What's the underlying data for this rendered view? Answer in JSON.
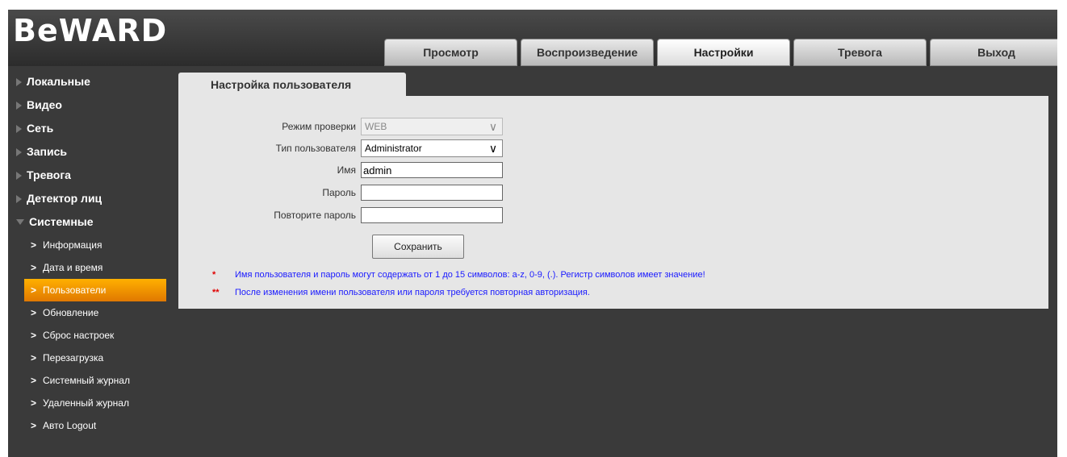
{
  "brand": "BeWARD",
  "tabs": [
    "Просмотр",
    "Воспроизведение",
    "Настройки",
    "Тревога",
    "Выход"
  ],
  "sidebar": {
    "sections": [
      "Локальные",
      "Видео",
      "Сеть",
      "Запись",
      "Тревога",
      "Детектор лиц",
      "Системные"
    ],
    "subitems": [
      "Информация",
      "Дата и время",
      "Пользователи",
      "Обновление",
      "Сброс настроек",
      "Перезагрузка",
      "Системный журнал",
      "Удаленный журнал",
      "Авто Logout"
    ]
  },
  "page": {
    "title": "Настройка пользователя"
  },
  "form": {
    "mode_label": "Режим проверки",
    "mode_value": "WEB",
    "type_label": "Тип пользователя",
    "type_value": "Administrator",
    "name_label": "Имя",
    "name_value": "admin",
    "password_label": "Пароль",
    "password_value": "",
    "repeat_label": "Повторите пароль",
    "repeat_value": "",
    "save_label": "Сохранить"
  },
  "notes": [
    {
      "mark": "*",
      "text": "Имя пользователя и пароль могут содержать от 1 до 15 символов: a-z, 0-9, (.). Регистр символов имеет значение!"
    },
    {
      "mark": "**",
      "text": "После изменения имени пользователя или пароля требуется повторная авторизация."
    }
  ],
  "colors": {
    "accent": "#f29100",
    "note_text": "#1a1aff",
    "note_mark": "#e00000"
  }
}
